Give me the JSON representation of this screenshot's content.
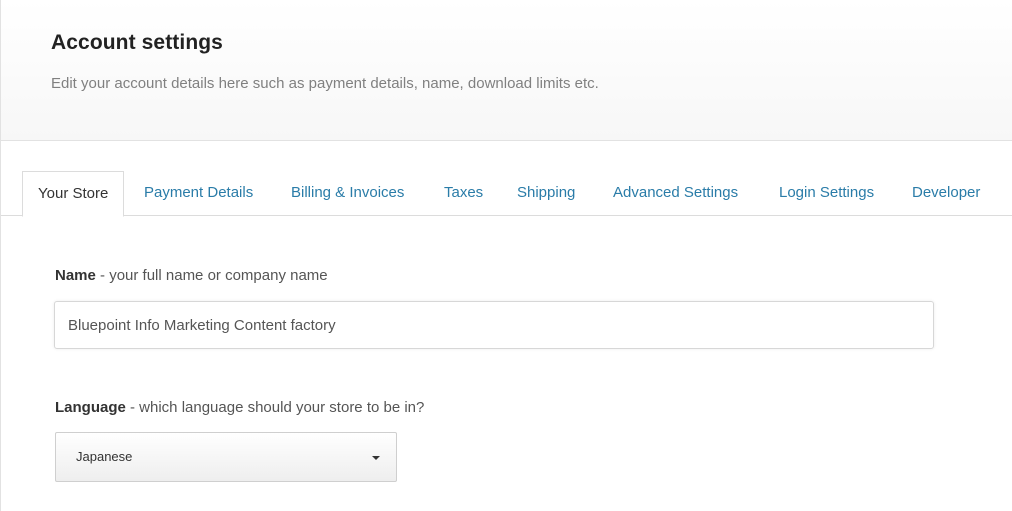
{
  "header": {
    "title": "Account settings",
    "subtitle": "Edit your account details here such as payment details, name, download limits etc."
  },
  "tabs": [
    {
      "label": "Your Store",
      "active": true
    },
    {
      "label": "Payment Details",
      "active": false
    },
    {
      "label": "Billing & Invoices",
      "active": false
    },
    {
      "label": "Taxes",
      "active": false
    },
    {
      "label": "Shipping",
      "active": false
    },
    {
      "label": "Advanced Settings",
      "active": false
    },
    {
      "label": "Login Settings",
      "active": false
    },
    {
      "label": "Developer",
      "active": false
    }
  ],
  "form": {
    "name": {
      "label": "Name",
      "hint": " - your full name or company name",
      "value": "Bluepoint Info Marketing Content factory"
    },
    "language": {
      "label": "Language",
      "hint": " - which language should your store to be in?",
      "selected": "Japanese"
    }
  },
  "colors": {
    "link": "#2a7ca8",
    "border": "#dcdcdc"
  }
}
